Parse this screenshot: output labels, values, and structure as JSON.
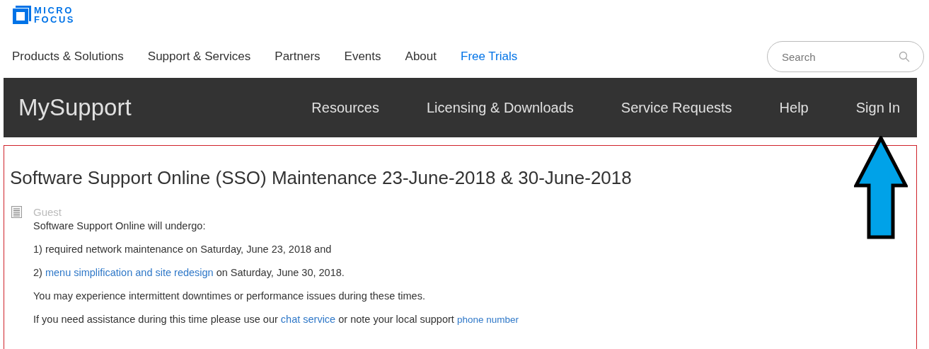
{
  "logo": {
    "line_1": "MICRO",
    "line_2": "FOCUS"
  },
  "top_nav": [
    {
      "label": "Products & Solutions",
      "kind": "plain"
    },
    {
      "label": "Support & Services",
      "kind": "plain"
    },
    {
      "label": "Partners",
      "kind": "plain"
    },
    {
      "label": "Events",
      "kind": "plain"
    },
    {
      "label": "About",
      "kind": "plain"
    },
    {
      "label": "Free Trials",
      "kind": "highlight"
    }
  ],
  "search": {
    "placeholder": "Search"
  },
  "support_bar": {
    "title": "MySupport",
    "items": [
      "Resources",
      "Licensing & Downloads",
      "Service Requests",
      "Help",
      "Sign In"
    ]
  },
  "article": {
    "title": "Software Support Online (SSO) Maintenance 23-June-2018 & 30-June-2018",
    "author": "Guest",
    "paragraphs": [
      [
        {
          "text": "Software Support Online will undergo:",
          "kind": "text"
        }
      ],
      [
        {
          "text": "1) required network maintenance on Saturday, June 23, 2018 and",
          "kind": "text"
        }
      ],
      [
        {
          "text": "2) ",
          "kind": "text"
        },
        {
          "text": "menu simplification and site redesign",
          "kind": "link"
        },
        {
          "text": " on Saturday, June 30, 2018.",
          "kind": "text"
        }
      ],
      [
        {
          "text": "You may experience intermittent downtimes or performance issues during these times.",
          "kind": "text"
        }
      ],
      [
        {
          "text": "If you need assistance during this time please use our ",
          "kind": "text"
        },
        {
          "text": "chat service",
          "kind": "link"
        },
        {
          "text": " or note your local support ",
          "kind": "text"
        },
        {
          "text": "phone number",
          "kind": "small_link"
        }
      ]
    ]
  }
}
